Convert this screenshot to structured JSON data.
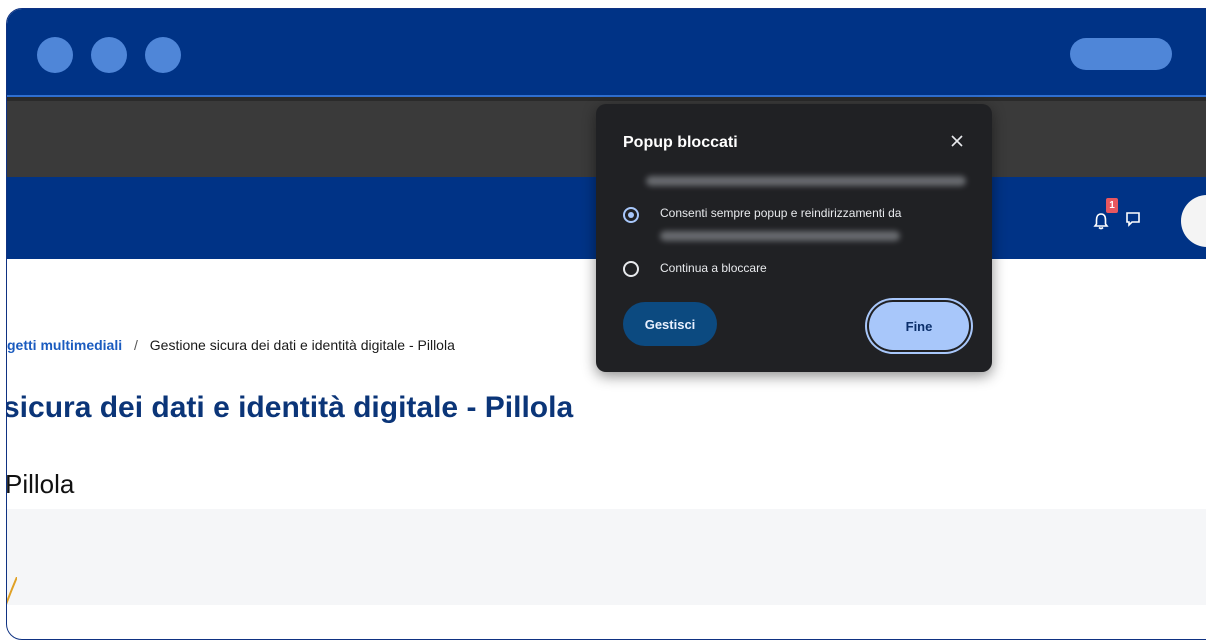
{
  "window": {
    "controls": [
      "circle",
      "circle",
      "circle"
    ]
  },
  "site_header": {
    "notification_count": "1"
  },
  "breadcrumb": {
    "link_label": "getti multimediali",
    "separator": "/",
    "current": "Gestione sicura dei dati e identità digitale - Pillola"
  },
  "page": {
    "title": "sicura dei dati e identità digitale - Pillola",
    "subtitle": "Pillola"
  },
  "popup": {
    "title": "Popup bloccati",
    "close_icon": "close-icon",
    "options": [
      {
        "label": "Consenti sempre popup e reindirizzamenti da",
        "checked": true
      },
      {
        "label": "Continua a bloccare",
        "checked": false
      }
    ],
    "manage_label": "Gestisci",
    "done_label": "Fine"
  },
  "colors": {
    "brand_blue": "#003386",
    "link_blue": "#1a5bbf",
    "popup_bg": "#202124",
    "accent_button": "#a8c7fa"
  }
}
